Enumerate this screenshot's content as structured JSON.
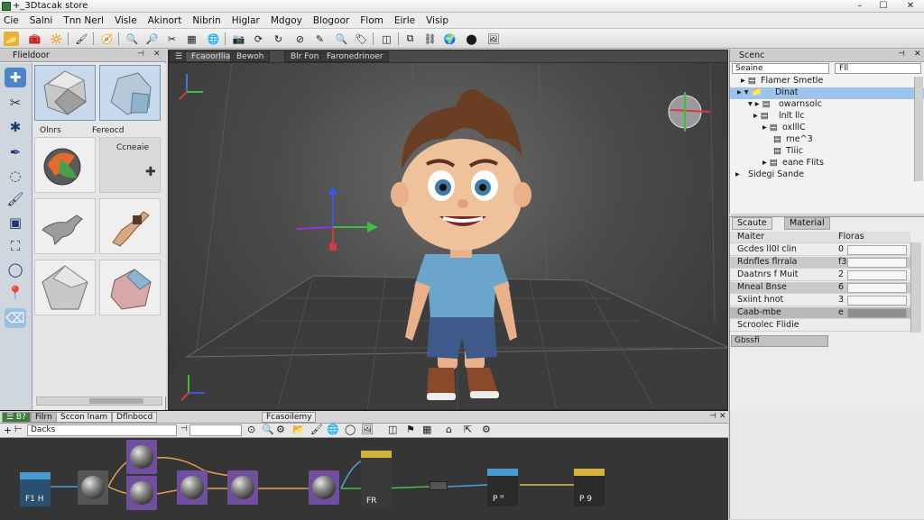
{
  "window": {
    "title": "+_3Dtacak store",
    "min": "–",
    "max": "☐",
    "close": "✕"
  },
  "menu": [
    "Cie",
    "Salni",
    "Tnn Nerl",
    "Visle",
    "Akinort",
    "Nibrin",
    "Higlar",
    "Mdgoy",
    "Blogoor",
    "Flom",
    "Eirle",
    "Visip"
  ],
  "asset_panel": {
    "title": "Flieldoor",
    "header_pin": "⊣",
    "header_close": "✕",
    "labels": {
      "obj_a": "Olnrs",
      "obj_b": "Fereocd",
      "obj_c": "Ccneaie"
    }
  },
  "viewport": {
    "tabs": [
      "☰",
      "Fcaoorllian",
      "Bewoh",
      "Blr Fon",
      "Faronedrinoer"
    ]
  },
  "scene_panel": {
    "title": "Scenc",
    "header_pin": "⊣",
    "header_close": "✕",
    "search": "Seaine",
    "filter": "Fll",
    "tree": [
      "Flamer Smetle",
      "Dinat",
      "owarnsolc",
      "lnlt llc",
      "oxlllC",
      "rne^3",
      "Tliic",
      "eane Flits",
      "Sidegi Sande"
    ]
  },
  "material_panel": {
    "tabs": [
      "Scaute",
      "Material"
    ],
    "head": [
      "Maiter",
      "Floras"
    ],
    "rows": [
      {
        "name": "Gcdes ll0l clin",
        "value": "0"
      },
      {
        "name": "Rdnfles flrrala",
        "value": "f3"
      },
      {
        "name": "Daatnrs f Muit",
        "value": "2"
      },
      {
        "name": "Mneal Bnse",
        "value": "6"
      },
      {
        "name": "Sxiint hnot",
        "value": "3"
      },
      {
        "name": "Caab-mbe",
        "value": "e"
      },
      {
        "name": "Scroolec Flidie",
        "value": ""
      }
    ],
    "search_label": "Gbssfi"
  },
  "node_editor": {
    "tabs": [
      "☰ B?",
      "Filrn",
      "Sccon lnam",
      "Dflnbocd",
      "Fcasoilemy"
    ],
    "filter": "Dacks",
    "node_labels": [
      "F1 H",
      "FR",
      "P ᴴ",
      "P 9"
    ]
  },
  "colors": {
    "accent": "#4a86c8",
    "node_purple": "#6f4f9e",
    "node_blue": "#3e86c4",
    "node_yellow": "#d3b23d"
  }
}
